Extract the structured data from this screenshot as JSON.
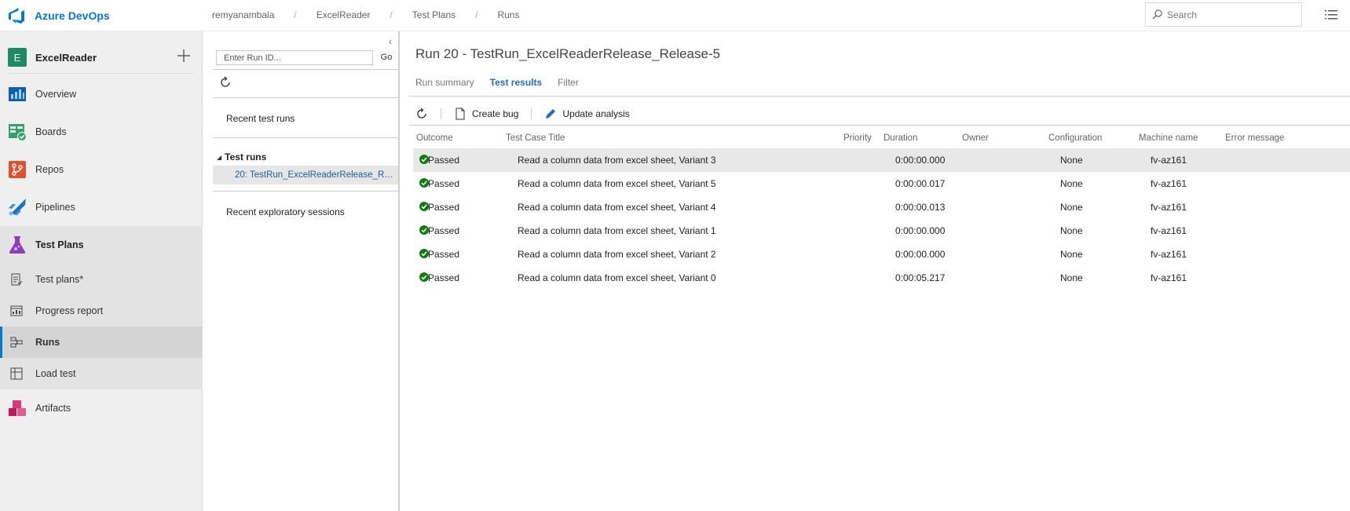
{
  "topbar": {
    "brand": "Azure DevOps",
    "breadcrumb": [
      "remyanambala",
      "ExcelReader",
      "Test Plans",
      "Runs"
    ],
    "search_placeholder": "Search"
  },
  "project": {
    "initial": "E",
    "name": "ExcelReader"
  },
  "nav": {
    "overview": "Overview",
    "boards": "Boards",
    "repos": "Repos",
    "pipelines": "Pipelines",
    "test_plans": "Test Plans",
    "test_plans_sub": "Test plans*",
    "progress_report": "Progress report",
    "runs": "Runs",
    "load_test": "Load test",
    "artifacts": "Artifacts"
  },
  "midpanel": {
    "runid_placeholder": "Enter Run ID...",
    "go_label": "Go",
    "recent_runs": "Recent test runs",
    "test_runs_header": "Test runs",
    "selected_run": "20: TestRun_ExcelReaderRelease_Rel...",
    "recent_sessions": "Recent exploratory sessions"
  },
  "main": {
    "title": "Run 20 - TestRun_ExcelReaderRelease_Release-5",
    "tabs": [
      "Run summary",
      "Test results",
      "Filter"
    ],
    "toolbar": {
      "create_bug": "Create bug",
      "update_analysis": "Update analysis"
    },
    "columns": {
      "outcome": "Outcome",
      "title": "Test Case Title",
      "priority": "Priority",
      "duration": "Duration",
      "owner": "Owner",
      "configuration": "Configuration",
      "machine": "Machine name",
      "error": "Error message"
    },
    "rows": [
      {
        "outcome": "Passed",
        "title": "Read a column data from excel sheet, Variant 3",
        "duration": "0:00:00.000",
        "config": "None",
        "machine": "fv-az161"
      },
      {
        "outcome": "Passed",
        "title": "Read a column data from excel sheet, Variant 5",
        "duration": "0:00:00.017",
        "config": "None",
        "machine": "fv-az161"
      },
      {
        "outcome": "Passed",
        "title": "Read a column data from excel sheet, Variant 4",
        "duration": "0:00:00.013",
        "config": "None",
        "machine": "fv-az161"
      },
      {
        "outcome": "Passed",
        "title": "Read a column data from excel sheet, Variant 1",
        "duration": "0:00:00.000",
        "config": "None",
        "machine": "fv-az161"
      },
      {
        "outcome": "Passed",
        "title": "Read a column data from excel sheet, Variant 2",
        "duration": "0:00:00.000",
        "config": "None",
        "machine": "fv-az161"
      },
      {
        "outcome": "Passed",
        "title": "Read a column data from excel sheet, Variant 0",
        "duration": "0:00:05.217",
        "config": "None",
        "machine": "fv-az161"
      }
    ]
  },
  "colors": {
    "accent": "#0078d4",
    "pass": "#107c10"
  }
}
